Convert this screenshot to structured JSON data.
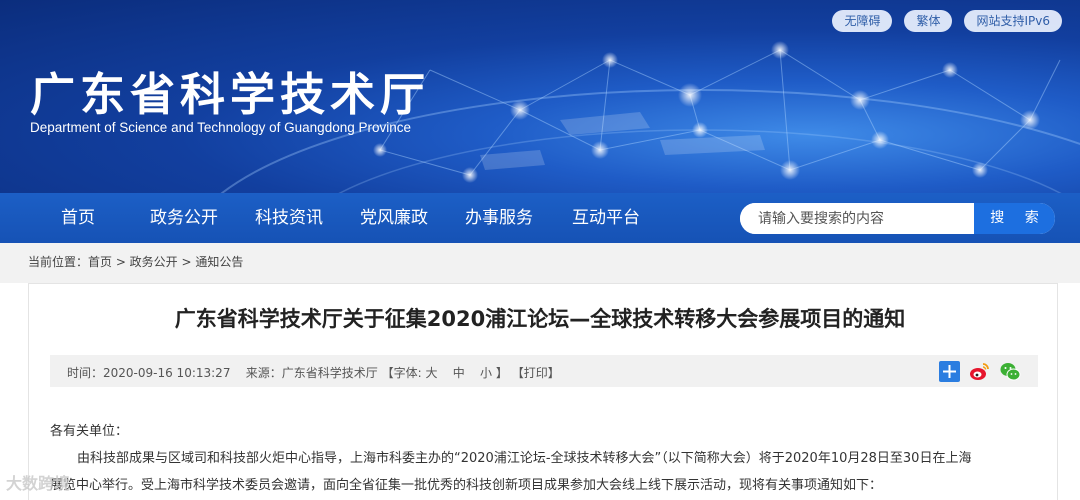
{
  "top_links": [
    "无障碍",
    "繁体",
    "网站支持IPv6"
  ],
  "site": {
    "title": "广东省科学技术厅",
    "subtitle": "Department of Science and Technology of Guangdong Province"
  },
  "nav": {
    "items": [
      "首页",
      "政务公开",
      "科技资讯",
      "党风廉政",
      "办事服务",
      "互动平台"
    ]
  },
  "search": {
    "placeholder": "请输入要搜索的内容",
    "button": "搜 索"
  },
  "breadcrumb": "当前位置：首页 > 政务公开 > 通知公告",
  "article": {
    "title": "广东省科学技术厅关于征集2020浦江论坛—全球技术转移大会参展项目的通知",
    "meta": {
      "time": "时间：2020-09-16 10:13:27",
      "source": "来源：广东省科学技术厅",
      "font_label": "【字体:",
      "font_large": "大",
      "font_medium": "中",
      "font_small": "小",
      "font_close": "】",
      "print": "【打印】"
    },
    "salutation": "各有关单位：",
    "paragraph_line1": "由科技部成果与区域司和科技部火炬中心指导，上海市科委主办的“2020浦江论坛-全球技术转移大会”（以下简称大会）将于2020年10月28日至30日在上海",
    "paragraph_line2": "展览中心举行。受上海市科学技术委员会邀请，面向全省征集一批优秀的科技创新项目成果参加大会线上线下展示活动，现将有关事项通知如下："
  },
  "share_icons": [
    "share-plus-icon",
    "weibo-icon",
    "wechat-icon"
  ],
  "watermark": "大数跨境",
  "colors": {
    "header_dark": "#0b2d7d",
    "nav": "#1c5fc6",
    "search_button": "#1d6fe0"
  }
}
